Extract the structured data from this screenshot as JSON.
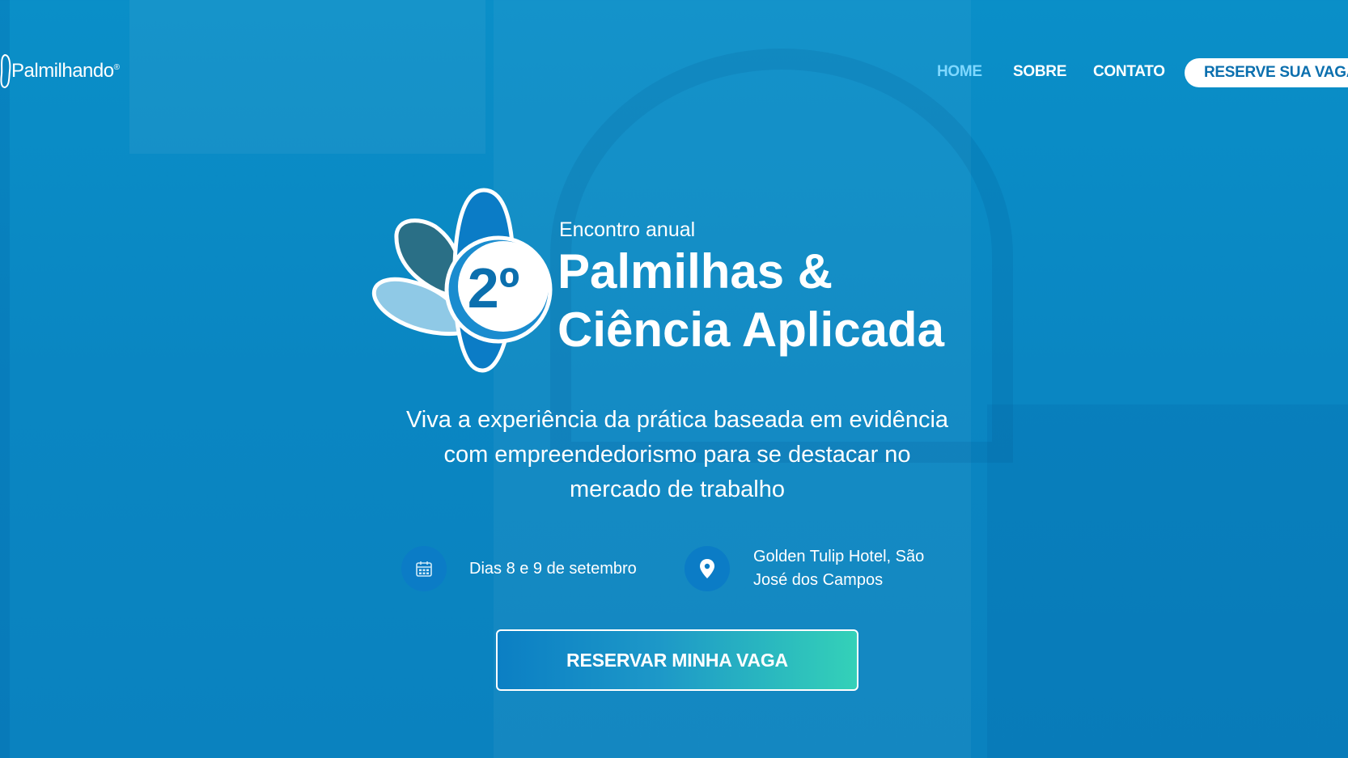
{
  "header": {
    "logo_text": "Palmilhando",
    "logo_mark": "®",
    "nav": {
      "home": "HOME",
      "sobre": "SOBRE",
      "contato": "CONTATO"
    },
    "cta_label": "RESERVE SUA VAGA"
  },
  "hero": {
    "emblem_number": "2º",
    "kicker": "Encontro anual",
    "title_line1": "Palmilhas &",
    "title_line2": "Ciência Aplicada",
    "subtitle": "Viva a experiência da prática baseada em evidência com empreendedorismo para se destacar no mercado de trabalho",
    "date": {
      "icon": "calendar-icon",
      "text": "Dias 8 e 9 de setembro"
    },
    "location": {
      "icon": "map-pin-icon",
      "text": "Golden Tulip Hotel, São José dos Campos"
    },
    "cta_label": "RESERVAR MINHA VAGA"
  },
  "colors": {
    "background": "#0a8fc8",
    "nav_active": "#7fd8ff",
    "cta_text": "#0b6fae",
    "cta_gradient_start": "#0b7fc4",
    "cta_gradient_end": "#34d1b8",
    "icon_circle": "#0b7cc6"
  }
}
